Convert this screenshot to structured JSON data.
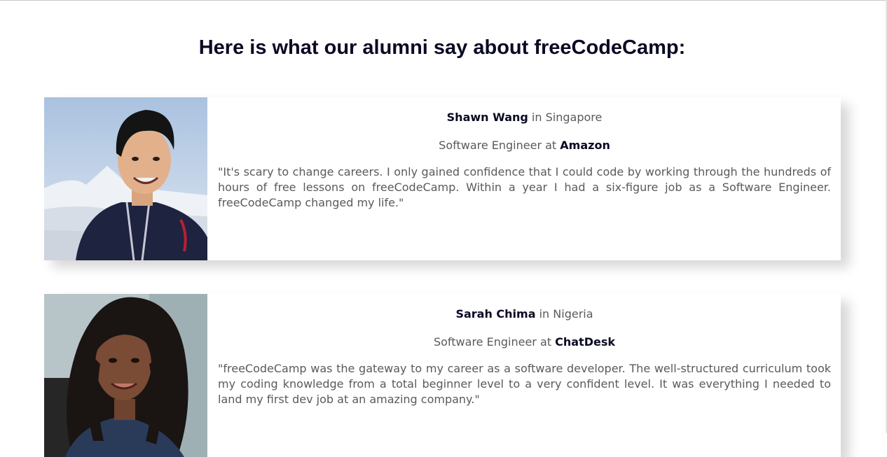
{
  "heading": "Here is what our alumni say about freeCodeCamp:",
  "testimonials": [
    {
      "name": "Shawn Wang",
      "location_prefix": "in",
      "location": "Singapore",
      "role": "Software Engineer at",
      "company": "Amazon",
      "quote": "\"It's scary to change careers. I only gained confidence that I could code by working through the hundreds of hours of free lessons on freeCodeCamp. Within a year I had a six-figure job as a Software Engineer. freeCodeCamp changed my life.\""
    },
    {
      "name": "Sarah Chima",
      "location_prefix": "in",
      "location": "Nigeria",
      "role": "Software Engineer at",
      "company": "ChatDesk",
      "quote": "\"freeCodeCamp was the gateway to my career as a software developer. The well-structured curriculum took my coding knowledge from a total beginner level to a very confident level. It was everything I needed to land my first dev job at an amazing company.\""
    }
  ],
  "colors": {
    "heading": "#0a0a23",
    "body_text": "#5a5a5a",
    "background": "#ffffff"
  }
}
